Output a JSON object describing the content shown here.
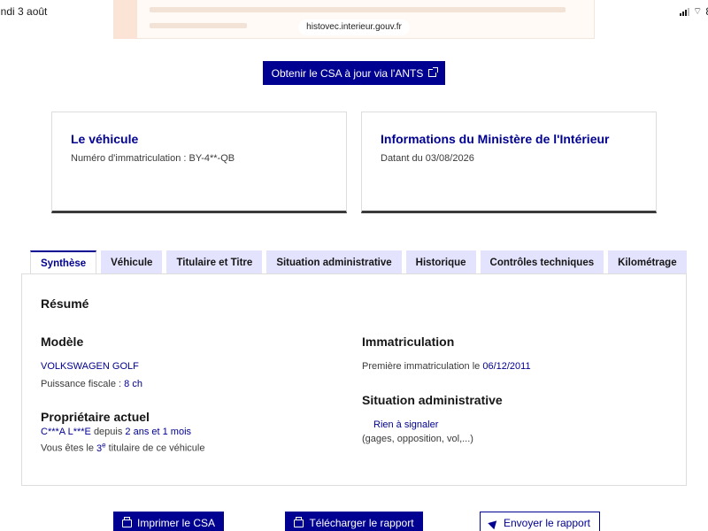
{
  "status_bar": {
    "date": "undi 3 août",
    "right": "8"
  },
  "browser": {
    "url": "histovec.interieur.gouv.fr"
  },
  "ants_button": {
    "label": "Obtenir le CSA à jour via l'ANTS"
  },
  "cards": {
    "vehicle": {
      "title": "Le véhicule",
      "subtitle": "Numéro d'immatriculation : BY-4**-QB"
    },
    "ministry": {
      "title": "Informations du Ministère de l'Intérieur",
      "subtitle": "Datant du 03/08/2026"
    }
  },
  "tabs": [
    "Synthèse",
    "Véhicule",
    "Titulaire et Titre",
    "Situation administrative",
    "Historique",
    "Contrôles techniques",
    "Kilométrage"
  ],
  "summary": {
    "title": "Résumé",
    "model": {
      "title": "Modèle",
      "name": "VOLKSWAGEN GOLF",
      "power_label": "Puissance fiscale :",
      "power_value": "8 ch"
    },
    "owner": {
      "title": "Propriétaire actuel",
      "name": "C***A L***E",
      "since_label": "depuis",
      "since_value": "2 ans et 1 mois",
      "rank_prefix": "Vous êtes le",
      "rank_num": "3",
      "rank_sup": "e",
      "rank_suffix": "titulaire de ce véhicule"
    },
    "registration": {
      "title": "Immatriculation",
      "label": "Première immatriculation le",
      "date": "06/12/2011"
    },
    "admin": {
      "title": "Situation administrative",
      "status": "Rien à signaler",
      "detail": "(gages, opposition, vol,...)"
    }
  },
  "actions": {
    "print": "Imprimer le CSA",
    "download": "Télécharger le rapport",
    "send": "Envoyer le rapport"
  },
  "colors": {
    "primary": "#000091",
    "tab_bg": "#e3e3fd",
    "text": "#161616"
  }
}
